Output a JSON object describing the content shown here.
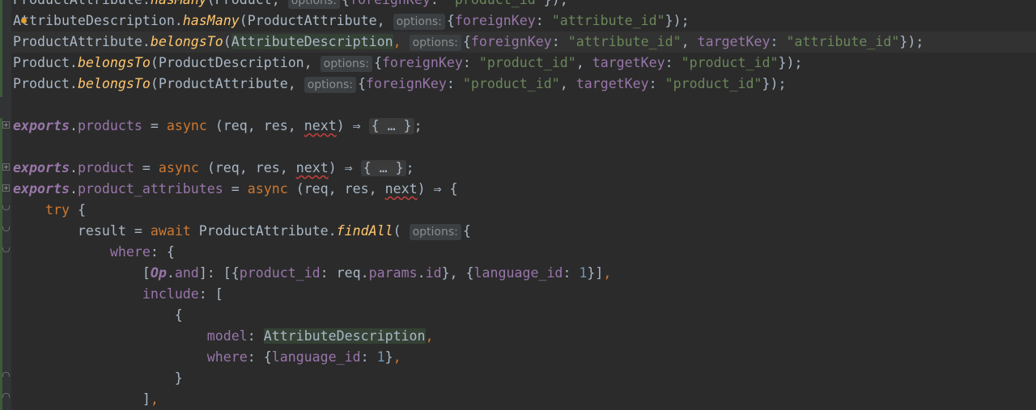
{
  "editor": {
    "language": "javascript",
    "lines": [
      {
        "parts": [
          [
            "ident",
            "ProductAttribute."
          ],
          [
            "fn",
            "hasMany"
          ],
          [
            "ident",
            "(Product, "
          ],
          [
            "hint",
            "options:"
          ],
          [
            "ident",
            "{"
          ],
          [
            "prop",
            "foreignKey"
          ],
          [
            "ident",
            ": "
          ],
          [
            "str",
            "\"product_id\""
          ],
          [
            "ident",
            "});"
          ]
        ]
      },
      {
        "parts": [
          [
            "ident",
            "AttributeDescription."
          ],
          [
            "fn",
            "hasMany"
          ],
          [
            "ident",
            "(ProductAttribute, "
          ],
          [
            "hint",
            "options:"
          ],
          [
            "ident",
            "{"
          ],
          [
            "prop",
            "foreignKey"
          ],
          [
            "ident",
            ": "
          ],
          [
            "str",
            "\"attribute_id\""
          ],
          [
            "ident",
            "});"
          ]
        ]
      },
      {
        "parts": [
          [
            "ident",
            "ProductAttribute."
          ],
          [
            "fn",
            "belongsTo"
          ],
          [
            "ident",
            "("
          ],
          [
            "hl",
            "AttributeDescription"
          ],
          [
            "kw",
            ", "
          ],
          [
            "hint",
            "options:"
          ],
          [
            "ident",
            "{"
          ],
          [
            "prop",
            "foreignKey"
          ],
          [
            "ident",
            ": "
          ],
          [
            "str",
            "\"attribute_id\""
          ],
          [
            "ident",
            ", "
          ],
          [
            "prop",
            "targetKey"
          ],
          [
            "ident",
            ": "
          ],
          [
            "str",
            "\"attribute_id\""
          ],
          [
            "ident",
            "});"
          ]
        ]
      },
      {
        "parts": [
          [
            "ident",
            "Product."
          ],
          [
            "fn",
            "belongsTo"
          ],
          [
            "ident",
            "(ProductDescription, "
          ],
          [
            "hint",
            "options:"
          ],
          [
            "ident",
            "{"
          ],
          [
            "prop",
            "foreignKey"
          ],
          [
            "ident",
            ": "
          ],
          [
            "str",
            "\"product_id\""
          ],
          [
            "ident",
            ", "
          ],
          [
            "prop",
            "targetKey"
          ],
          [
            "ident",
            ": "
          ],
          [
            "str",
            "\"product_id\""
          ],
          [
            "ident",
            "});"
          ]
        ]
      },
      {
        "parts": [
          [
            "ident",
            "Product."
          ],
          [
            "fn",
            "belongsTo"
          ],
          [
            "ident",
            "(ProductAttribute, "
          ],
          [
            "hint",
            "options:"
          ],
          [
            "ident",
            "{"
          ],
          [
            "prop",
            "foreignKey"
          ],
          [
            "ident",
            ": "
          ],
          [
            "str",
            "\"product_id\""
          ],
          [
            "ident",
            ", "
          ],
          [
            "prop",
            "targetKey"
          ],
          [
            "ident",
            ": "
          ],
          [
            "str",
            "\"product_id\""
          ],
          [
            "ident",
            "});"
          ]
        ]
      },
      {
        "parts": []
      },
      {
        "parts": [
          [
            "exp",
            "exports"
          ],
          [
            "ident",
            "."
          ],
          [
            "prop",
            "products"
          ],
          [
            "ident",
            " = "
          ],
          [
            "kw",
            "async "
          ],
          [
            "ident",
            "(req, res, "
          ],
          [
            "unused",
            "next"
          ],
          [
            "ident",
            ") ⇒ "
          ],
          [
            "folded",
            "{ … }"
          ],
          [
            "ident",
            ";"
          ]
        ]
      },
      {
        "parts": []
      },
      {
        "parts": [
          [
            "exp",
            "exports"
          ],
          [
            "ident",
            "."
          ],
          [
            "prop",
            "product"
          ],
          [
            "ident",
            " = "
          ],
          [
            "kw",
            "async "
          ],
          [
            "ident",
            "(req, res, "
          ],
          [
            "unused",
            "next"
          ],
          [
            "ident",
            ") ⇒ "
          ],
          [
            "folded",
            "{ … }"
          ],
          [
            "ident",
            ";"
          ]
        ]
      },
      {
        "parts": [
          [
            "exp",
            "exports"
          ],
          [
            "ident",
            "."
          ],
          [
            "prop",
            "product_attributes"
          ],
          [
            "ident",
            " = "
          ],
          [
            "kw",
            "async "
          ],
          [
            "ident",
            "(req, res, "
          ],
          [
            "unused",
            "next"
          ],
          [
            "ident",
            ") ⇒ {"
          ]
        ]
      },
      {
        "parts": [
          [
            "ident",
            "    "
          ],
          [
            "kw",
            "try "
          ],
          [
            "ident",
            "{"
          ]
        ]
      },
      {
        "parts": [
          [
            "ident",
            "        result = "
          ],
          [
            "kw",
            "await "
          ],
          [
            "ident",
            "ProductAttribute."
          ],
          [
            "fn",
            "findAll"
          ],
          [
            "ident",
            "( "
          ],
          [
            "hint",
            "options:"
          ],
          [
            "ident",
            "{"
          ]
        ]
      },
      {
        "parts": [
          [
            "ident",
            "            "
          ],
          [
            "prop",
            "where"
          ],
          [
            "ident",
            ": {"
          ]
        ]
      },
      {
        "parts": [
          [
            "ident",
            "                ["
          ],
          [
            "op",
            "Op"
          ],
          [
            "ident",
            "."
          ],
          [
            "prop",
            "and"
          ],
          [
            "ident",
            "]: [{"
          ],
          [
            "prop",
            "product_id"
          ],
          [
            "ident",
            ": req."
          ],
          [
            "prop",
            "params"
          ],
          [
            "ident",
            "."
          ],
          [
            "prop",
            "id"
          ],
          [
            "ident",
            "}, {"
          ],
          [
            "prop",
            "language_id"
          ],
          [
            "ident",
            ": "
          ],
          [
            "num",
            "1"
          ],
          [
            "ident",
            "}]"
          ],
          [
            "kw",
            ","
          ]
        ]
      },
      {
        "parts": [
          [
            "ident",
            "                "
          ],
          [
            "prop",
            "include"
          ],
          [
            "ident",
            ": ["
          ]
        ]
      },
      {
        "parts": [
          [
            "ident",
            "                    {"
          ]
        ]
      },
      {
        "parts": [
          [
            "ident",
            "                        "
          ],
          [
            "prop",
            "model"
          ],
          [
            "ident",
            ": "
          ],
          [
            "hl",
            "AttributeDescription"
          ],
          [
            "kw",
            ","
          ]
        ]
      },
      {
        "parts": [
          [
            "ident",
            "                        "
          ],
          [
            "prop",
            "where"
          ],
          [
            "ident",
            ": {"
          ],
          [
            "prop",
            "language_id"
          ],
          [
            "ident",
            ": "
          ],
          [
            "num",
            "1"
          ],
          [
            "ident",
            "}"
          ],
          [
            "kw",
            ","
          ]
        ]
      },
      {
        "parts": [
          [
            "ident",
            "                    }"
          ]
        ]
      },
      {
        "parts": [
          [
            "ident",
            "                ]"
          ],
          [
            "kw",
            ","
          ]
        ]
      }
    ]
  },
  "colors": {
    "background": "#2b2b2b",
    "keyword": "#cc7832",
    "function": "#ffc66d",
    "string": "#6a8759",
    "number": "#6897bb",
    "property": "#9876aa"
  }
}
